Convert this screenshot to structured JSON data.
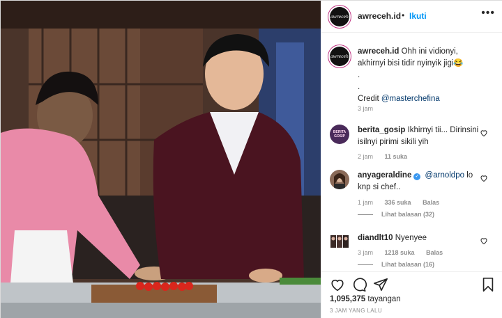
{
  "header": {
    "username": "awreceh.id",
    "separator": "•",
    "follow_label": "Ikuti",
    "more_label": "•••",
    "avatar_text": "awreceh"
  },
  "caption": {
    "username": "awreceh.id",
    "text": "Ohh ini vidionyi, akhirnyi bisi tidir nyinyik jigi😂",
    "dot1": ".",
    "dot2": ".",
    "credit_prefix": "Credit ",
    "credit_mention": "@masterchefina",
    "time": "3 jam"
  },
  "comments": [
    {
      "username": "berita_gosip",
      "text": "Ikhirnyi tii... Dirinsini isilnyi pirimi sikili yih",
      "time": "2 jam",
      "likes": "11 suka",
      "reply": "Balas",
      "avatar_text": "BERITA GOSIP"
    },
    {
      "username": "anyageraldine",
      "verified": "✓",
      "mention": "@arnoldpo",
      "text": "lo knp si chef..",
      "time": "1 jam",
      "likes": "336 suka",
      "reply": "Balas",
      "view_replies": "Lihat balasan (32)"
    },
    {
      "username": "diandlt10",
      "text": "Nyenyee",
      "time": "3 jam",
      "likes": "1218 suka",
      "reply": "Balas",
      "view_replies": "Lihat balasan (16)"
    }
  ],
  "footer": {
    "views_count": "1,095,375",
    "views_label": " tayangan",
    "time_ago": "3 JAM YANG LALU"
  },
  "icons": {
    "like": "heart-icon",
    "comment": "comment-icon",
    "share": "share-icon",
    "save": "bookmark-icon"
  },
  "colors": {
    "link_blue": "#0095f6",
    "mention_blue": "#00376b",
    "meta_gray": "#8e8e8e",
    "border": "#dbdbdb"
  }
}
